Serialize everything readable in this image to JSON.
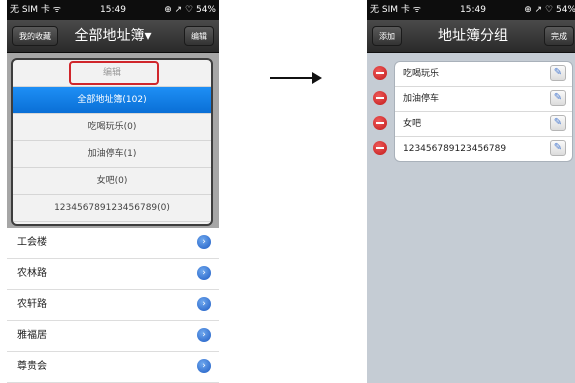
{
  "status_bar": {
    "carrier": "无 SIM 卡 ᯤ",
    "time": "15:49",
    "right": "⊕ ↗ ♡ 54%"
  },
  "left": {
    "nav": {
      "left_button": "我的收藏",
      "title": "全部地址簿▾",
      "right_button": "编辑"
    },
    "popup": [
      {
        "label": "编辑",
        "kind": "edit"
      },
      {
        "label": "全部地址簿(102)",
        "kind": "selected"
      },
      {
        "label": "吃喝玩乐(0)",
        "kind": "normal"
      },
      {
        "label": "加油停车(1)",
        "kind": "normal"
      },
      {
        "label": "女吧(0)",
        "kind": "normal"
      },
      {
        "label": "123456789123456789(0)",
        "kind": "normal"
      }
    ],
    "list": [
      "工会楼",
      "农林路",
      "农轩路",
      "雅福居",
      "尊贵会"
    ]
  },
  "right": {
    "nav": {
      "left_button": "添加",
      "title": "地址簿分组",
      "right_button": "完成"
    },
    "groups": [
      "吃喝玩乐",
      "加油停车",
      "女吧",
      "123456789123456789"
    ]
  },
  "icons": {
    "arrow": "arrow-right",
    "disclosure": "chevron-right",
    "delete": "minus-circle",
    "edit": "pencil"
  }
}
